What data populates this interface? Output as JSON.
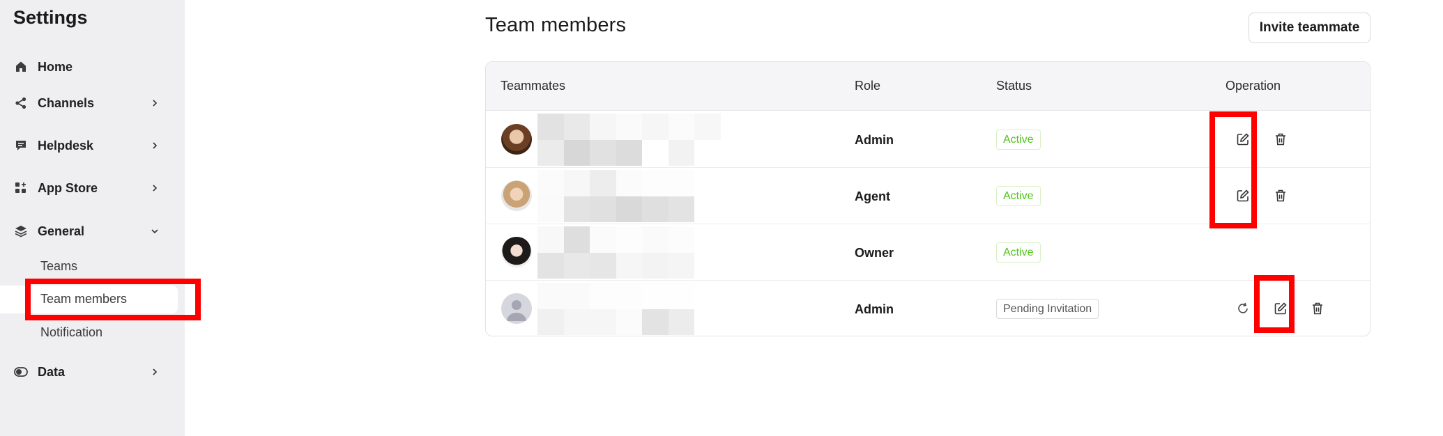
{
  "sidebar": {
    "title": "Settings",
    "items": [
      {
        "label": "Home",
        "icon": "home-icon"
      },
      {
        "label": "Channels",
        "icon": "share-icon"
      },
      {
        "label": "Helpdesk",
        "icon": "chat-icon"
      },
      {
        "label": "App Store",
        "icon": "apps-icon"
      },
      {
        "label": "General",
        "icon": "layers-icon"
      },
      {
        "label": "Data",
        "icon": "toggle-icon"
      }
    ],
    "general_sub": [
      {
        "label": "Teams"
      },
      {
        "label": "Team members"
      },
      {
        "label": "Notification"
      }
    ]
  },
  "main": {
    "title": "Team members",
    "invite_label": "Invite teammate",
    "table": {
      "headers": [
        "Teammates",
        "Role",
        "Status",
        "Operation"
      ],
      "rows": [
        {
          "role": "Admin",
          "status": "Active"
        },
        {
          "role": "Agent",
          "status": "Active"
        },
        {
          "role": "Owner",
          "status": "Active"
        },
        {
          "role": "Admin",
          "status": "Pending Invitation"
        }
      ]
    }
  },
  "colors": {
    "sidebar_bg": "#efeff1",
    "highlight": "#ff0000",
    "active_status": "#52c41a"
  }
}
